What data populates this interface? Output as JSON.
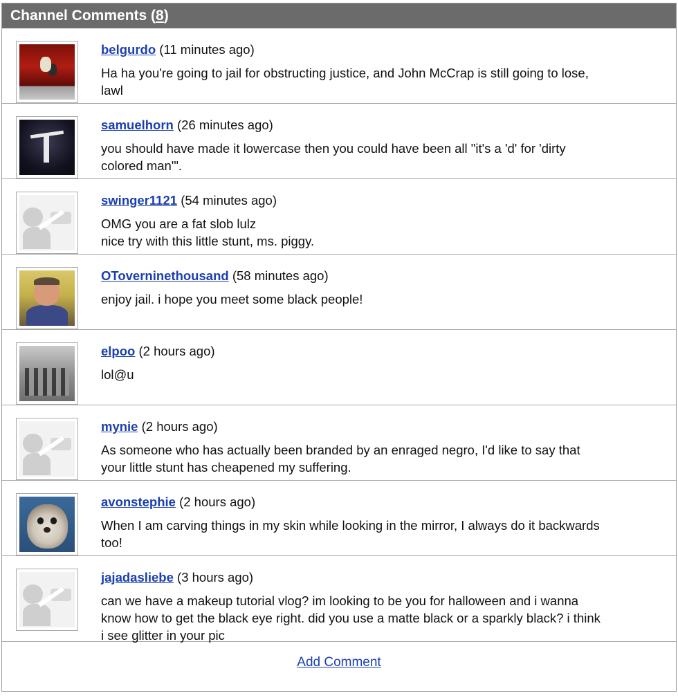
{
  "header": {
    "title": "Channel Comments",
    "count": "8"
  },
  "comments": [
    {
      "user": "belgurdo",
      "time": "(11 minutes ago)",
      "text": "Ha ha you're going to jail for obstructing justice, and John McCrap is still going to lose,\nlawl",
      "avatar": "stage-photo"
    },
    {
      "user": "samuelhorn",
      "time": "(26 minutes ago)",
      "text": "you should have made it lowercase then you could have been all \"it's a 'd' for 'dirty\ncolored man'\".",
      "avatar": "dancer-photo"
    },
    {
      "user": "swinger1121",
      "time": "(54 minutes ago)",
      "text": "OMG you are a fat slob lulz\nnice try with this little stunt, ms. piggy.",
      "avatar": "default-avatar"
    },
    {
      "user": "OToverninethousand",
      "time": "(58 minutes ago)",
      "text": "enjoy jail. i hope you meet some black people!",
      "avatar": "man-photo"
    },
    {
      "user": "elpoo",
      "time": "(2 hours ago)",
      "text": "lol@u",
      "avatar": "group-photo"
    },
    {
      "user": "mynie",
      "time": "(2 hours ago)",
      "text": "As someone who has actually been branded by an enraged negro, I'd like to say that\nyour little stunt has cheapened my suffering.",
      "avatar": "default-avatar"
    },
    {
      "user": "avonstephie",
      "time": "(2 hours ago)",
      "text": "When I am carving things in my skin while looking in the mirror, I always do it backwards\ntoo!",
      "avatar": "cat-photo"
    },
    {
      "user": "jajadasliebe",
      "time": "(3 hours ago)",
      "text": "can we have a makeup tutorial vlog? im looking to be you for halloween and i wanna\nknow how to get the black eye right. did you use a matte black or a sparkly black? i think\ni see glitter in your pic",
      "avatar": "default-avatar"
    }
  ],
  "footer": {
    "add_comment": "Add Comment"
  }
}
